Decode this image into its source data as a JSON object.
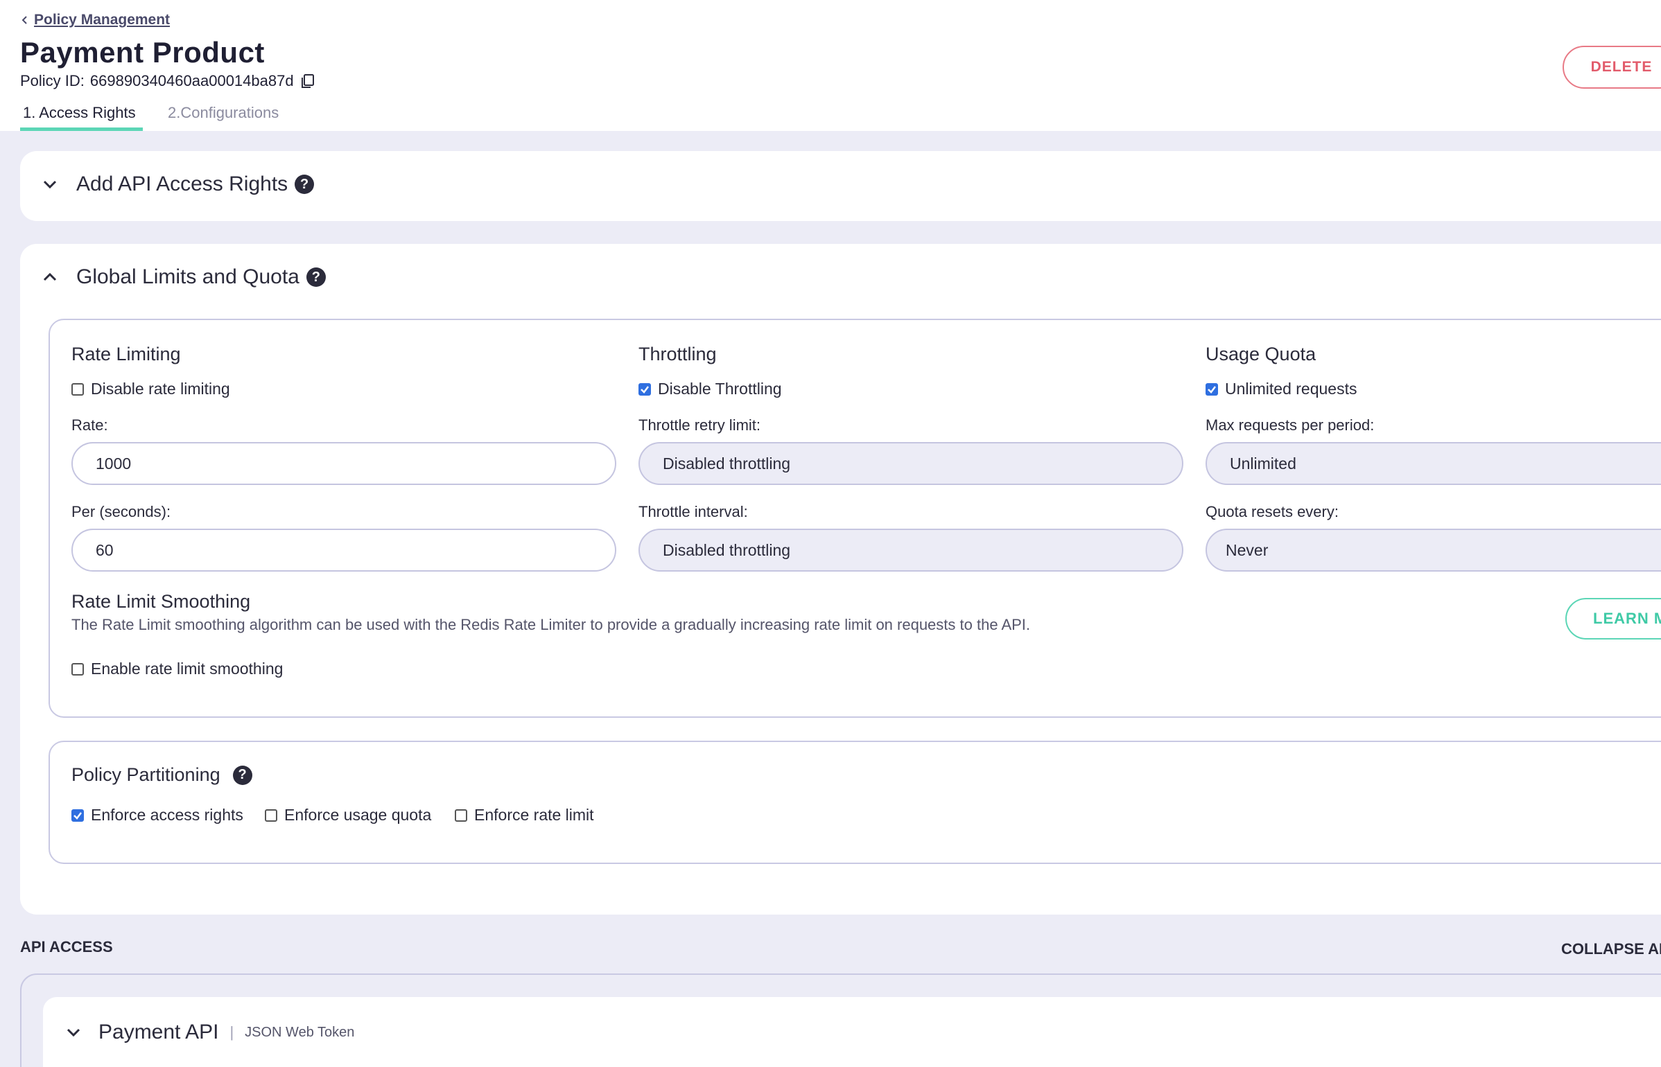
{
  "header": {
    "breadcrumb": "Policy Management",
    "title": "Payment Product",
    "policy_id_label": "Policy ID:",
    "policy_id": "669890340460aa00014ba87d",
    "delete_label": "DELETE",
    "tabs": [
      {
        "label": "1. Access Rights",
        "active": true
      },
      {
        "label": "2.Configurations",
        "active": false
      }
    ]
  },
  "add_access": {
    "title": "Add API Access Rights",
    "expanded": false
  },
  "global_limits": {
    "title": "Global Limits and Quota",
    "expanded": true,
    "rate_limiting": {
      "title": "Rate Limiting",
      "disable_label": "Disable rate limiting",
      "disable_checked": false,
      "rate_label": "Rate:",
      "rate_value": "1000",
      "per_label": "Per (seconds):",
      "per_value": "60"
    },
    "throttling": {
      "title": "Throttling",
      "disable_label": "Disable Throttling",
      "disable_checked": true,
      "retry_label": "Throttle retry limit:",
      "retry_value": "Disabled throttling",
      "interval_label": "Throttle interval:",
      "interval_value": "Disabled throttling"
    },
    "usage_quota": {
      "title": "Usage Quota",
      "unlimited_label": "Unlimited requests",
      "unlimited_checked": true,
      "max_label": "Max requests per period:",
      "max_value": "Unlimited",
      "resets_label": "Quota resets every:",
      "resets_value": "Never"
    },
    "smoothing": {
      "title": "Rate Limit Smoothing",
      "description": "The Rate Limit smoothing algorithm can be used with the Redis Rate Limiter to provide a gradually increasing rate limit on requests to the API.",
      "learn_label": "LEARN M",
      "enable_label": "Enable rate limit smoothing",
      "enable_checked": false
    },
    "partitioning": {
      "title": "Policy Partitioning",
      "options": [
        {
          "label": "Enforce access rights",
          "checked": true
        },
        {
          "label": "Enforce usage quota",
          "checked": false
        },
        {
          "label": "Enforce rate limit",
          "checked": false
        }
      ]
    }
  },
  "api_access": {
    "label": "API ACCESS",
    "collapse_label": "COLLAPSE AL",
    "apis": [
      {
        "name": "Payment API",
        "auth": "JSON Web Token"
      }
    ]
  },
  "colors": {
    "accent": "#5cd6b6",
    "danger": "#e25b6b",
    "checkbox": "#2f6fe0",
    "background": "#ececf6"
  }
}
